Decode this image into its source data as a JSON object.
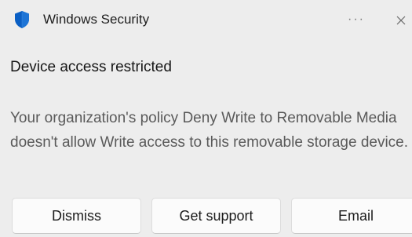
{
  "header": {
    "app_name": "Windows Security",
    "more_label": "···",
    "icon": "shield-icon",
    "close_icon": "close-icon"
  },
  "notification": {
    "title": "Device access restricted",
    "body": "Your organization's policy Deny Write to Removable Media doesn't allow Write access to this removable storage device."
  },
  "actions": {
    "dismiss_label": "Dismiss",
    "support_label": "Get support",
    "email_label": "Email"
  },
  "colors": {
    "background": "#ededed",
    "shield": "#0a5fc4",
    "body_text": "#5a5a5a"
  }
}
